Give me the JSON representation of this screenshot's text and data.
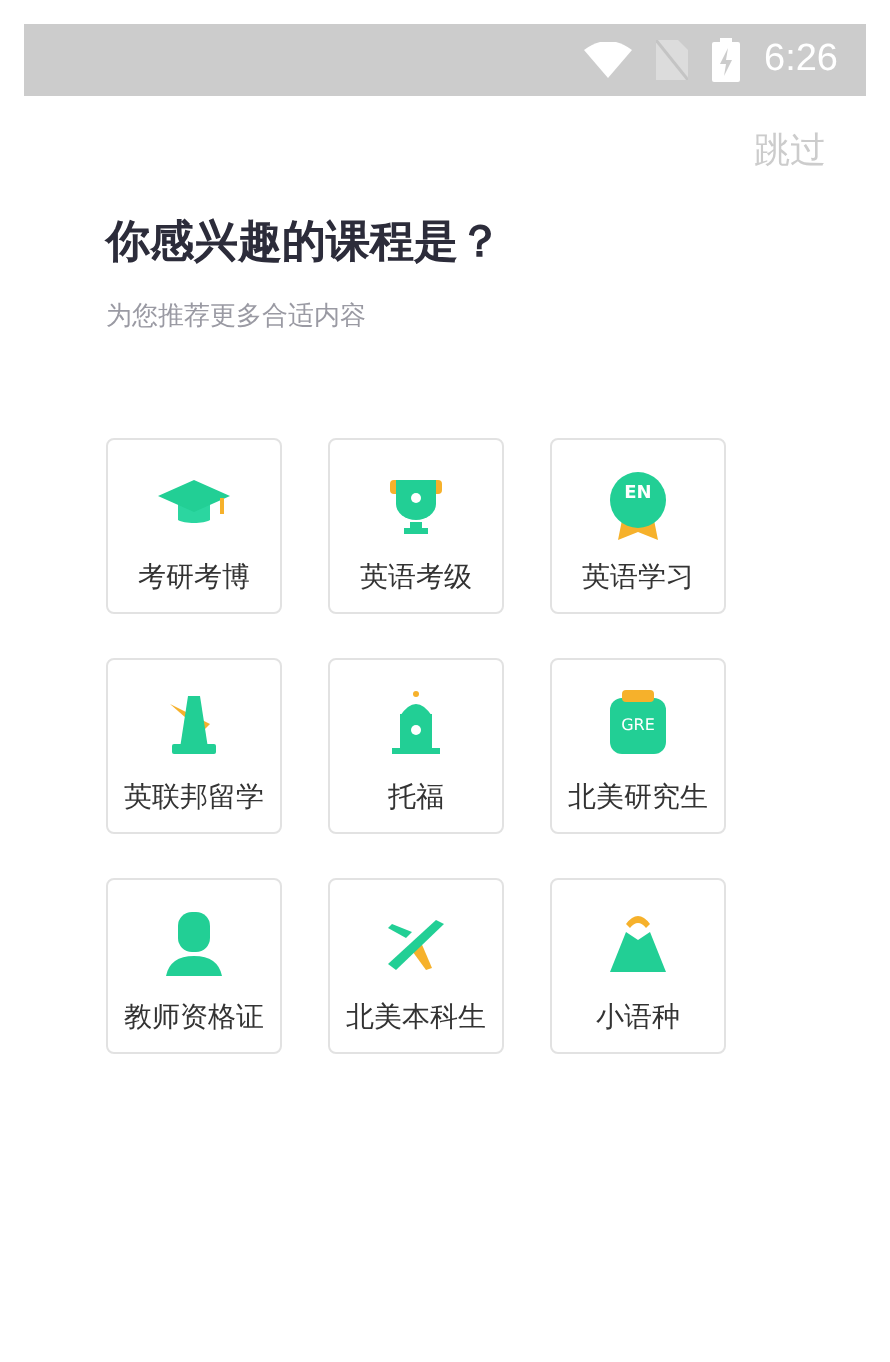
{
  "status_bar": {
    "time": "6:26"
  },
  "skip": "跳过",
  "title": "你感兴趣的课程是？",
  "subtitle": "为您推荐更多合适内容",
  "courses": [
    {
      "kind": "cap",
      "label": "考研考博"
    },
    {
      "kind": "trophy",
      "label": "英语考级"
    },
    {
      "kind": "medal",
      "label": "英语学习",
      "icon_text": "EN"
    },
    {
      "kind": "tower",
      "label": "英联邦留学"
    },
    {
      "kind": "building",
      "label": "托福"
    },
    {
      "kind": "clipboard",
      "label": "北美研究生",
      "icon_text": "GRE"
    },
    {
      "kind": "person",
      "label": "教师资格证"
    },
    {
      "kind": "plane",
      "label": "北美本科生"
    },
    {
      "kind": "mountain",
      "label": "小语种"
    }
  ]
}
